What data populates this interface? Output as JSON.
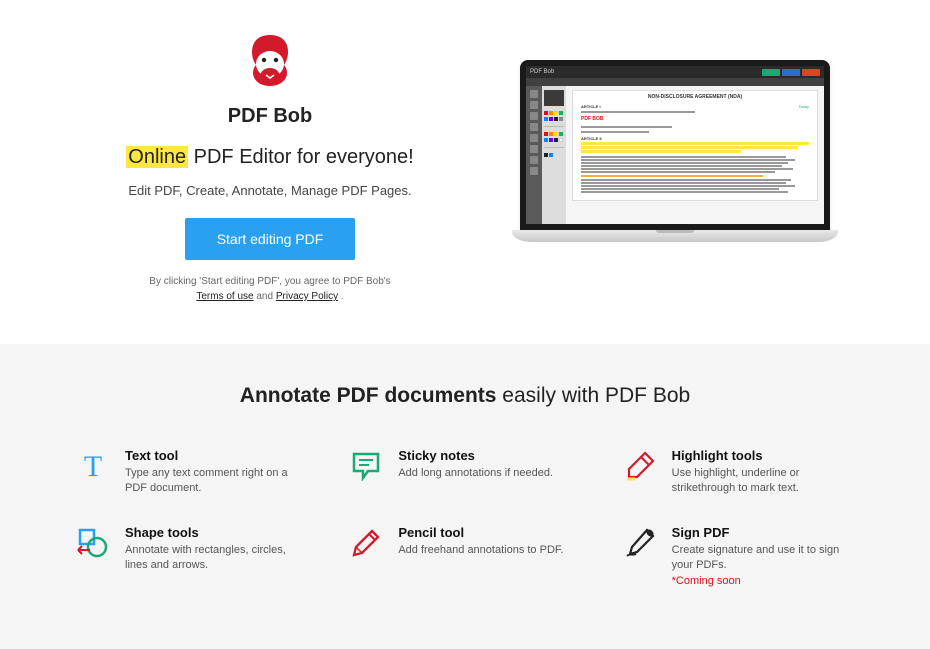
{
  "hero": {
    "brand": "PDF Bob",
    "headline_highlight": "Online",
    "headline_rest": " PDF Editor for everyone!",
    "subhead": "Edit PDF, Create, Annotate, Manage PDF Pages.",
    "cta_label": "Start editing PDF",
    "disclaimer_prefix": "By clicking 'Start editing PDF', you agree to PDF Bob's",
    "terms_label": "Terms of use",
    "and": " and ",
    "privacy_label": "Privacy Policy",
    "period": " ."
  },
  "screenshot": {
    "app_name": "PDF Bob",
    "doc_title": "NON-DISCLOSURE AGREEMENT (NDA)",
    "stamp": "PDF BOB",
    "link": "Today",
    "label1": "ARTICLE I",
    "label2": "ARTICLE II"
  },
  "features_section": {
    "title_bold": "Annotate PDF documents",
    "title_rest": " easily with PDF Bob"
  },
  "features": [
    {
      "title": "Text tool",
      "desc": "Type any text comment right on a PDF document."
    },
    {
      "title": "Sticky notes",
      "desc": "Add long annotations if needed."
    },
    {
      "title": "Highlight tools",
      "desc": "Use highlight, underline or strikethrough to mark text."
    },
    {
      "title": "Shape tools",
      "desc": "Annotate with rectangles, circles, lines and arrows."
    },
    {
      "title": "Pencil tool",
      "desc": "Add freehand annotations to PDF."
    },
    {
      "title": "Sign PDF",
      "desc": "Create signature and use it to sign your PDFs.",
      "note": "*Coming soon"
    }
  ]
}
